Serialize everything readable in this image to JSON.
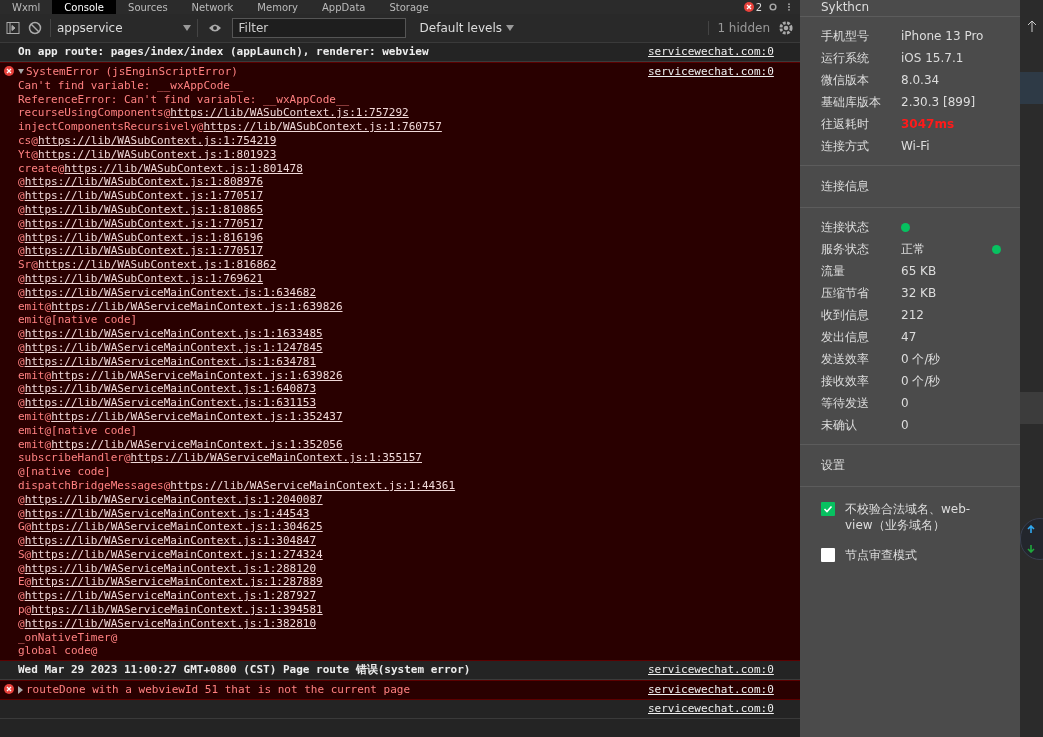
{
  "tabs": [
    {
      "label": "Wxml",
      "selected": false
    },
    {
      "label": "Console",
      "selected": true
    },
    {
      "label": "Sources",
      "selected": false
    },
    {
      "label": "Network",
      "selected": false
    },
    {
      "label": "Memory",
      "selected": false
    },
    {
      "label": "AppData",
      "selected": false
    },
    {
      "label": "Storage",
      "selected": false
    }
  ],
  "error_count": "2",
  "toolbar": {
    "context": "appservice",
    "filter": {
      "placeholder": "Filter"
    },
    "levels": "Default levels",
    "hidden": "1 hidden"
  },
  "entries": [
    {
      "kind": "info",
      "message": "On app route: pages/index/index (appLaunch), renderer: webview",
      "source": "servicewechat.com:0"
    },
    {
      "kind": "error",
      "expanded": true,
      "message": "SystemError (jsEnginScriptError)",
      "source": "servicewechat.com:0",
      "lines": [
        {
          "text": "Can't find variable: __wxAppCode__"
        },
        {
          "text": "ReferenceError: Can't find variable: __wxAppCode__"
        },
        {
          "text": "recurseUsingComponents@",
          "link": "https://lib/WASubContext.js:1:757292"
        },
        {
          "text": "injectComponentsRecursively@",
          "link": "https://lib/WASubContext.js:1:760757"
        },
        {
          "text": "cs@",
          "link": "https://lib/WASubContext.js:1:754219"
        },
        {
          "text": "Yt@",
          "link": "https://lib/WASubContext.js:1:801923"
        },
        {
          "text": "create@",
          "link": "https://lib/WASubContext.js:1:801478"
        },
        {
          "text": "@",
          "link": "https://lib/WASubContext.js:1:808976"
        },
        {
          "text": "@",
          "link": "https://lib/WASubContext.js:1:770517"
        },
        {
          "text": "@",
          "link": "https://lib/WASubContext.js:1:810865"
        },
        {
          "text": "@",
          "link": "https://lib/WASubContext.js:1:770517"
        },
        {
          "text": "@",
          "link": "https://lib/WASubContext.js:1:816196"
        },
        {
          "text": "@",
          "link": "https://lib/WASubContext.js:1:770517"
        },
        {
          "text": "Sr@",
          "link": "https://lib/WASubContext.js:1:816862"
        },
        {
          "text": "@",
          "link": "https://lib/WASubContext.js:1:769621"
        },
        {
          "text": "@",
          "link": "https://lib/WAServiceMainContext.js:1:634682"
        },
        {
          "text": "emit@",
          "link": "https://lib/WAServiceMainContext.js:1:639826"
        },
        {
          "text": "emit@[native code]"
        },
        {
          "text": "@",
          "link": "https://lib/WAServiceMainContext.js:1:1633485"
        },
        {
          "text": "@",
          "link": "https://lib/WAServiceMainContext.js:1:1247845"
        },
        {
          "text": "@",
          "link": "https://lib/WAServiceMainContext.js:1:634781"
        },
        {
          "text": "emit@",
          "link": "https://lib/WAServiceMainContext.js:1:639826"
        },
        {
          "text": "@",
          "link": "https://lib/WAServiceMainContext.js:1:640873"
        },
        {
          "text": "@",
          "link": "https://lib/WAServiceMainContext.js:1:631153"
        },
        {
          "text": "emit@",
          "link": "https://lib/WAServiceMainContext.js:1:352437"
        },
        {
          "text": "emit@[native code]"
        },
        {
          "text": "emit@",
          "link": "https://lib/WAServiceMainContext.js:1:352056"
        },
        {
          "text": "subscribeHandler@",
          "link": "https://lib/WAServiceMainContext.js:1:355157"
        },
        {
          "text": "@[native code]"
        },
        {
          "text": "dispatchBridgeMessages@",
          "link": "https://lib/WAServiceMainContext.js:1:44361"
        },
        {
          "text": "@",
          "link": "https://lib/WAServiceMainContext.js:1:2040087"
        },
        {
          "text": "@",
          "link": "https://lib/WAServiceMainContext.js:1:44543"
        },
        {
          "text": "G@",
          "link": "https://lib/WAServiceMainContext.js:1:304625"
        },
        {
          "text": "@",
          "link": "https://lib/WAServiceMainContext.js:1:304847"
        },
        {
          "text": "S@",
          "link": "https://lib/WAServiceMainContext.js:1:274324"
        },
        {
          "text": "@",
          "link": "https://lib/WAServiceMainContext.js:1:288120"
        },
        {
          "text": "E@",
          "link": "https://lib/WAServiceMainContext.js:1:287889"
        },
        {
          "text": "@",
          "link": "https://lib/WAServiceMainContext.js:1:287927"
        },
        {
          "text": "p@",
          "link": "https://lib/WAServiceMainContext.js:1:394581"
        },
        {
          "text": "@",
          "link": "https://lib/WAServiceMainContext.js:1:382810"
        },
        {
          "text": "_onNativeTimer@"
        },
        {
          "text": "global code@"
        }
      ]
    },
    {
      "kind": "info",
      "message": "Wed Mar 29 2023 11:00:27 GMT+0800 (CST) Page route 错误(system error)",
      "source": "servicewechat.com:0"
    },
    {
      "kind": "error",
      "expanded": false,
      "message": "routeDone with a webviewId 51 that is not the current page",
      "source": "servicewechat.com:0"
    },
    {
      "kind": "info",
      "source": "servicewechat.com:0"
    }
  ],
  "panel": {
    "header": "Sykthcn",
    "device": [
      {
        "label": "手机型号",
        "value": "iPhone 13 Pro",
        "alert": false
      },
      {
        "label": "运行系统",
        "value": "iOS 15.7.1",
        "alert": false
      },
      {
        "label": "微信版本",
        "value": "8.0.34",
        "alert": false
      },
      {
        "label": "基础库版本",
        "value": "2.30.3 [899]",
        "alert": false
      },
      {
        "label": "往返耗时",
        "value": "3047ms",
        "alert": true
      },
      {
        "label": "连接方式",
        "value": "Wi-Fi",
        "alert": false
      }
    ],
    "connection_title": "连接信息",
    "connection": [
      {
        "label": "连接状态",
        "color": "#07c160"
      },
      {
        "label": "服务状态",
        "value": "正常",
        "color": "#07c160"
      },
      {
        "label": "流量",
        "value": "65 KB"
      },
      {
        "label": "压缩节省",
        "value": "32 KB"
      },
      {
        "label": "收到信息",
        "value": "212"
      },
      {
        "label": "发出信息",
        "value": "47"
      },
      {
        "label": "发送效率",
        "value": "0 个/秒"
      },
      {
        "label": "接收效率",
        "value": "0 个/秒"
      },
      {
        "label": "等待发送",
        "value": "0"
      },
      {
        "label": "未确认",
        "value": "0"
      }
    ],
    "settings_title": "设置",
    "settings": [
      {
        "label": "不校验合法域名、web-view（业务域名）",
        "checked": true
      },
      {
        "label": "节点审查模式",
        "checked": false
      }
    ]
  }
}
